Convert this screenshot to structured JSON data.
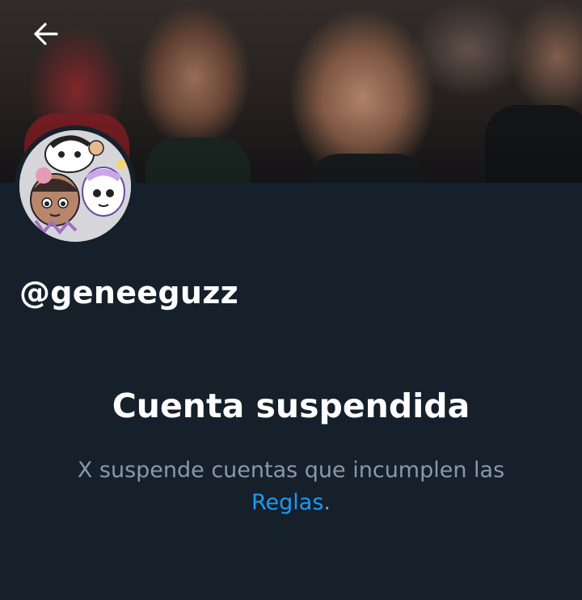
{
  "profile": {
    "handle": "@geneeguzz"
  },
  "suspension": {
    "title": "Cuenta suspendida",
    "message_before": "X suspende cuentas que incumplen las",
    "rules_link": "Reglas",
    "message_after": "."
  },
  "icons": {
    "back": "arrow-left-icon"
  },
  "colors": {
    "background": "#15202b",
    "text_primary": "#ffffff",
    "text_secondary": "#8b98a5",
    "link": "#1d9bf0"
  }
}
